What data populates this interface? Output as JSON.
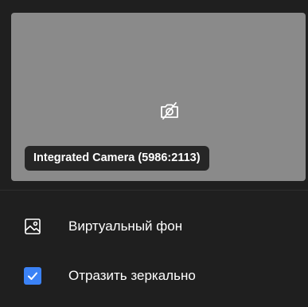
{
  "preview": {
    "camera_name": "Integrated Camera (5986:2113)",
    "status_icon": "camera-off-icon",
    "background_color": "#8a8a8a"
  },
  "options": [
    {
      "label": "Виртуальный фон",
      "icon": "image-icon"
    },
    {
      "label": "Отразить зеркально",
      "icon": "checkbox",
      "checked": true,
      "accent_color": "#3b82f6"
    }
  ]
}
